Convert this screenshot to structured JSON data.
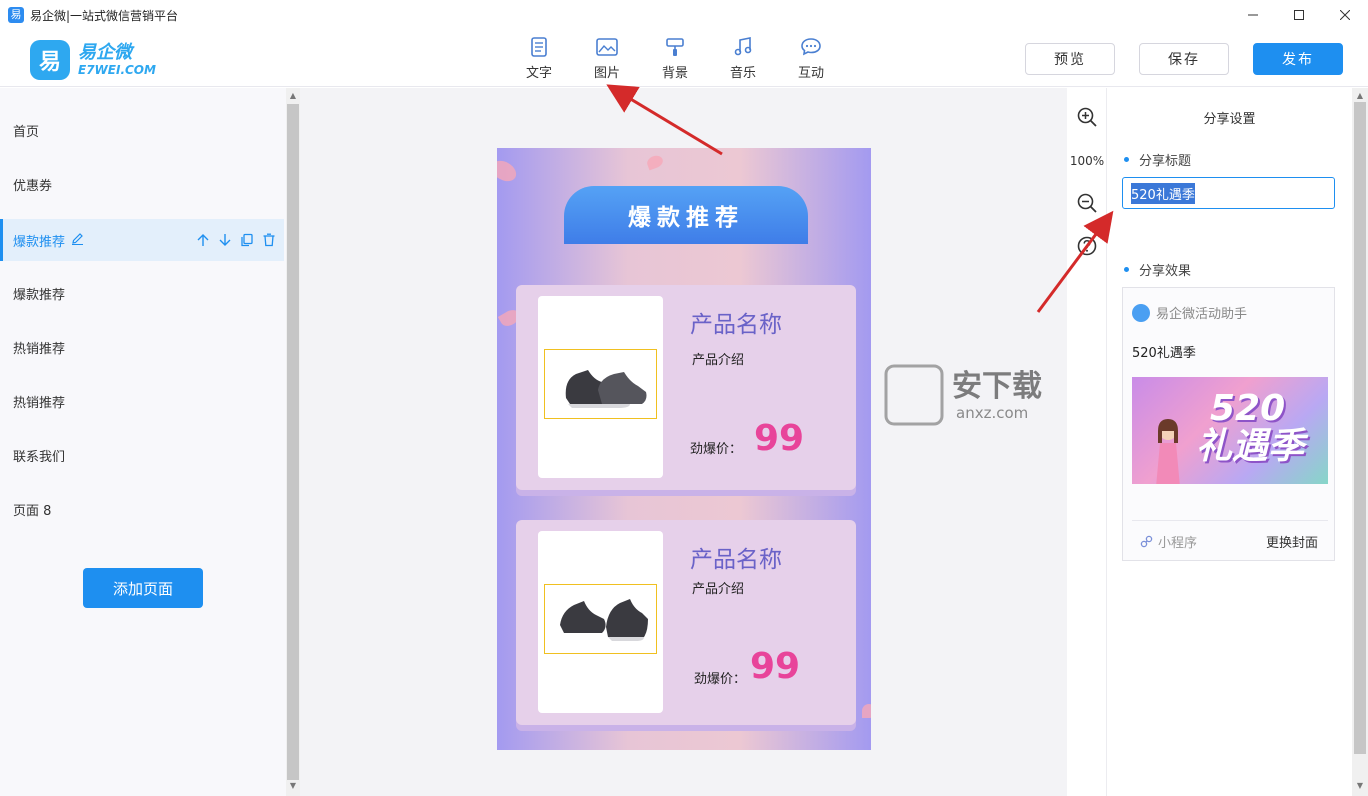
{
  "window": {
    "title": "易企微|一站式微信营销平台",
    "app_icon_char": "易"
  },
  "logo": {
    "mark": "易",
    "cn": "易企微",
    "en": "E7WEI.COM"
  },
  "toolbar": {
    "tools": [
      {
        "label": "文字",
        "icon": "text-doc-icon"
      },
      {
        "label": "图片",
        "icon": "image-icon"
      },
      {
        "label": "背景",
        "icon": "paint-roller-icon"
      },
      {
        "label": "音乐",
        "icon": "music-note-icon"
      },
      {
        "label": "互动",
        "icon": "chat-bubble-icon"
      }
    ],
    "preview_label": "预览",
    "save_label": "保存",
    "publish_label": "发布"
  },
  "sidebar": {
    "items": [
      {
        "label": "首页"
      },
      {
        "label": "优惠券"
      },
      {
        "label": "爆款推荐",
        "active": true
      },
      {
        "label": "爆款推荐"
      },
      {
        "label": "热销推荐"
      },
      {
        "label": "热销推荐"
      },
      {
        "label": "联系我们"
      },
      {
        "label": "页面 8"
      }
    ],
    "add_page_label": "添加页面"
  },
  "canvas": {
    "banner_title": "爆款推荐",
    "cards": [
      {
        "name": "产品名称",
        "intro": "产品介绍",
        "price_label": "劲爆价：",
        "price": "99"
      },
      {
        "name": "产品名称",
        "intro": "产品介绍",
        "price_label": "劲爆价：",
        "price": "99"
      }
    ],
    "watermark_text": "安下载",
    "watermark_sub": "anxz.com"
  },
  "zoom": {
    "level": "100%"
  },
  "share_panel": {
    "heading": "分享设置",
    "title_label": "分享标题",
    "title_value": "520礼遇季",
    "effect_label": "分享效果",
    "brand_name": "易企微活动助手",
    "preview_title": "520礼遇季",
    "cover_big": "520",
    "cover_sub": "礼遇季",
    "mini_program_label": "小程序",
    "change_cover_label": "更换封面"
  },
  "colors": {
    "accent": "#1e8ff0",
    "price": "#e8449a",
    "product_name": "#6a62c8"
  }
}
